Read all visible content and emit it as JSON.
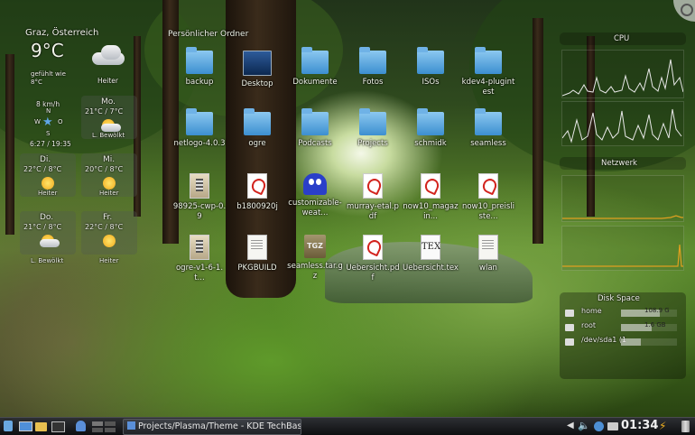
{
  "weather": {
    "location": "Graz, Österreich",
    "temperature": "9°C",
    "feels_like": "gefühlt wie\n8°C",
    "current_condition": "Heiter",
    "wind": "8 km/h",
    "wind_dir_n": "N",
    "wind_dir_w": "W",
    "wind_dir_o": "O",
    "wind_dir_s": "S",
    "sun_times": "6:27 / 19:35",
    "forecast": [
      {
        "day": "Mo.",
        "temps": "21°C / 7°C",
        "condition": "L. Bewölkt"
      },
      {
        "day": "Di.",
        "temps": "22°C / 8°C",
        "condition": "Heiter"
      },
      {
        "day": "Mi.",
        "temps": "20°C / 8°C",
        "condition": "Heiter"
      },
      {
        "day": "Do.",
        "temps": "21°C / 8°C",
        "condition": "L. Bewölkt"
      },
      {
        "day": "Fr.",
        "temps": "22°C / 8°C",
        "condition": "Heiter"
      }
    ]
  },
  "folderview": {
    "title": "Persönlicher Ordner",
    "items": [
      {
        "label": "backup",
        "type": "folder"
      },
      {
        "label": "Desktop",
        "type": "screen"
      },
      {
        "label": "Dokumente",
        "type": "folder"
      },
      {
        "label": "Fotos",
        "type": "folder"
      },
      {
        "label": "ISOs",
        "type": "folder"
      },
      {
        "label": "kdev4-plugintest",
        "type": "folder"
      },
      {
        "label": "netlogo-4.0.3",
        "type": "folder"
      },
      {
        "label": "ogre",
        "type": "folder"
      },
      {
        "label": "Podcasts",
        "type": "folder"
      },
      {
        "label": "Projects",
        "type": "folder"
      },
      {
        "label": "schmidk",
        "type": "folder"
      },
      {
        "label": "seamless",
        "type": "folder"
      },
      {
        "label": "98925-cwp-0.9",
        "type": "pkg"
      },
      {
        "label": "b1800920j",
        "type": "pdf"
      },
      {
        "label": "customizable-weat...",
        "type": "pac"
      },
      {
        "label": "murray-etal.pdf",
        "type": "pdf"
      },
      {
        "label": "now10_magazin...",
        "type": "pdf"
      },
      {
        "label": "now10_preisliste...",
        "type": "pdf"
      },
      {
        "label": "ogre-v1-6-1.t...",
        "type": "pkg"
      },
      {
        "label": "PKGBUILD",
        "type": "txt"
      },
      {
        "label": "seamless.tar.gz",
        "type": "tgz"
      },
      {
        "label": "Uebersicht.pdf",
        "type": "pdf"
      },
      {
        "label": "Uebersicht.tex",
        "type": "tex"
      },
      {
        "label": "wlan",
        "type": "txt"
      }
    ],
    "tgz_text": "TGZ",
    "tex_text": "TEX"
  },
  "sysmon": {
    "cpu_title": "CPU",
    "network_title": "Netzwerk",
    "disk_title": "Disk Space",
    "disks": [
      {
        "name": "home",
        "size": "108.9 G",
        "fill": 0.7
      },
      {
        "name": "root",
        "size": "1.6 GB",
        "fill": 0.55
      },
      {
        "name": "/dev/sda1 (1",
        "size": "",
        "fill": 0.35
      }
    ]
  },
  "taskbar": {
    "task_label": "Projects/Plasma/Theme - KDE TechBase",
    "clock": "01:34"
  },
  "colors": {
    "folder": "#5aa6e0",
    "pdf_red": "#d2231d",
    "taskbar": "#1a1b1e",
    "net_line": "#e0a020"
  }
}
